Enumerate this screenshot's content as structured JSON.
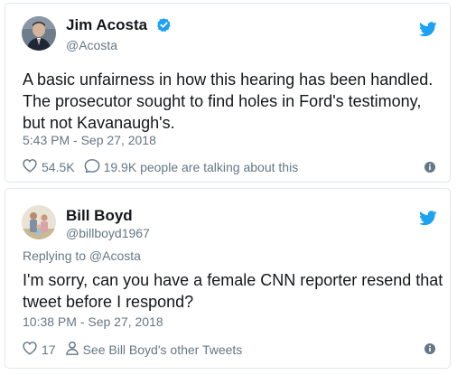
{
  "tweets": [
    {
      "author_name": "Jim Acosta",
      "handle": "@Acosta",
      "verified": true,
      "text": "A basic unfairness in how this hearing has been handled. The prosecutor sought to find holes in Ford's testimony, but not Kavanaugh's.",
      "timestamp": "5:43 PM - Sep 27, 2018",
      "likes": "54.5K",
      "secondary_action": "19.9K people are talking about this",
      "secondary_icon": "comment-icon"
    },
    {
      "author_name": "Bill Boyd",
      "handle": "@billboyd1967",
      "verified": false,
      "replying_to": "Replying to @Acosta",
      "text": "I'm sorry, can you have a female CNN reporter resend that tweet before I respond?",
      "timestamp": "10:38 PM - Sep 27, 2018",
      "likes": "17",
      "secondary_action": "See Bill Boyd's other Tweets",
      "secondary_icon": "person-icon"
    }
  ],
  "colors": {
    "twitter_blue": "#1da1f2",
    "secondary_text": "#657786",
    "primary_text": "#14171a",
    "border": "#e1e8ed"
  }
}
